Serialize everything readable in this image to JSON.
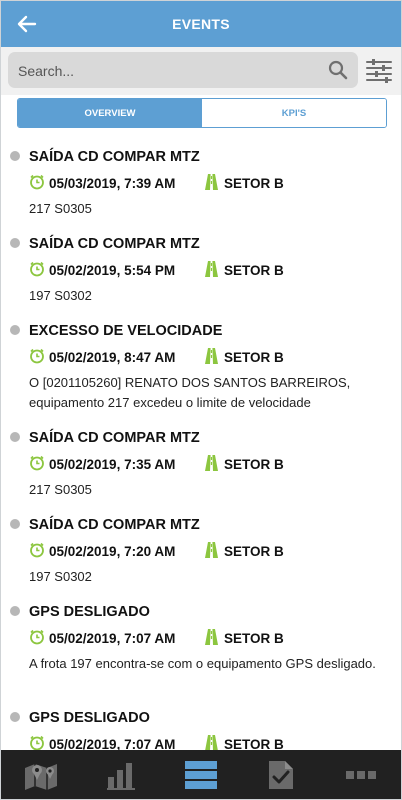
{
  "header": {
    "title": "EVENTS"
  },
  "search": {
    "placeholder": "Search..."
  },
  "tabs": [
    {
      "label": "OVERVIEW",
      "active": true
    },
    {
      "label": "KPI'S",
      "active": false
    }
  ],
  "events": [
    {
      "title": "SAÍDA CD COMPAR MTZ",
      "datetime": "05/03/2019, 7:39 AM",
      "sector": "SETOR B",
      "description": "217 S0305"
    },
    {
      "title": "SAÍDA CD COMPAR MTZ",
      "datetime": "05/02/2019, 5:54 PM",
      "sector": "SETOR B",
      "description": "197 S0302"
    },
    {
      "title": "EXCESSO DE VELOCIDADE",
      "datetime": "05/02/2019, 8:47 AM",
      "sector": "SETOR B",
      "description": "O [0201105260] RENATO DOS SANTOS BARREIROS, equipamento 217 excedeu o limite de velocidade"
    },
    {
      "title": "SAÍDA CD COMPAR MTZ",
      "datetime": "05/02/2019, 7:35 AM",
      "sector": "SETOR B",
      "description": "217 S0305"
    },
    {
      "title": "SAÍDA CD COMPAR MTZ",
      "datetime": "05/02/2019, 7:20 AM",
      "sector": "SETOR B",
      "description": "197 S0302"
    },
    {
      "title": "GPS DESLIGADO",
      "datetime": "05/02/2019, 7:07 AM",
      "sector": "SETOR B",
      "description": "A frota 197 encontra-se com o equipamento GPS desligado."
    },
    {
      "title": "GPS DESLIGADO",
      "datetime": "05/02/2019, 7:07 AM",
      "sector": "SETOR B",
      "description": ""
    }
  ],
  "bottom_nav": [
    {
      "icon": "map-icon",
      "active": false
    },
    {
      "icon": "bar-chart-icon",
      "active": false
    },
    {
      "icon": "list-icon",
      "active": true
    },
    {
      "icon": "checklist-icon",
      "active": false
    },
    {
      "icon": "more-icon",
      "active": false
    }
  ],
  "colors": {
    "accent": "#5d9fd3",
    "icon_green": "#8cc63f",
    "bottom_bar": "#212121",
    "dot": "#b7b7b7"
  }
}
